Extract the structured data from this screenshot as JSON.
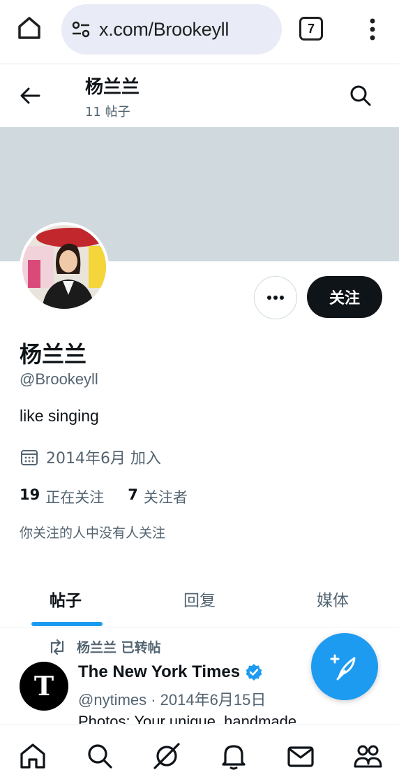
{
  "browser": {
    "url": "x.com/Brookeyll",
    "tab_count": "7"
  },
  "header": {
    "name": "杨兰兰",
    "post_count": "11 帖子"
  },
  "profile": {
    "display_name": "杨兰兰",
    "handle": "@Brookeyll",
    "bio": "like singing",
    "joined": "2014年6月 加入",
    "following_count": "19",
    "following_label": "正在关注",
    "followers_count": "7",
    "followers_label": "关注者",
    "mutual_note": "你关注的人中没有人关注",
    "follow_button": "关注"
  },
  "tabs": [
    {
      "label": "帖子",
      "active": true
    },
    {
      "label": "回复",
      "active": false
    },
    {
      "label": "媒体",
      "active": false
    }
  ],
  "tweet": {
    "retweet_note": "杨兰兰 已转帖",
    "author": "The New York Times",
    "meta": "@nytimes · 2014年6月15日",
    "text": "Photos: Your unique, handmade"
  },
  "colors": {
    "accent": "#1d9bf0",
    "banner": "#cfd9de",
    "follow_bg": "#0f1419"
  }
}
